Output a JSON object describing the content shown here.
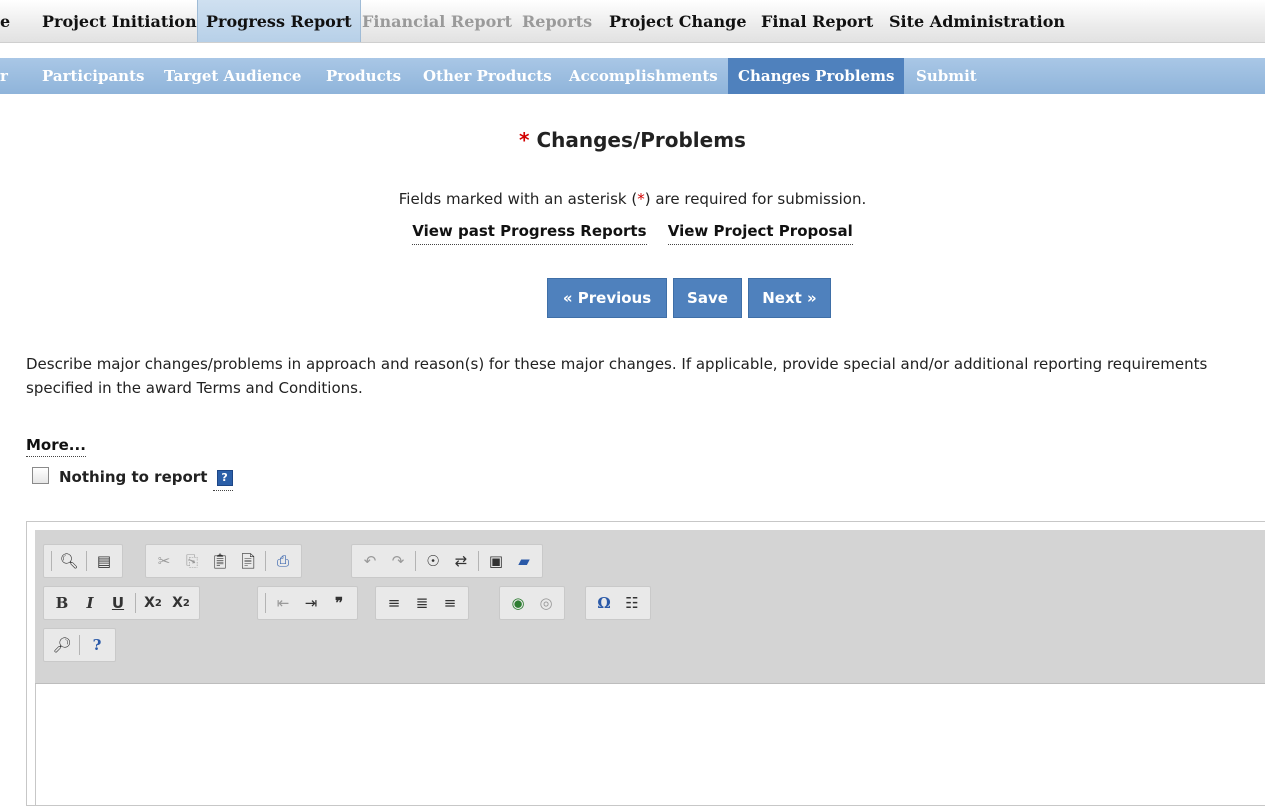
{
  "top_nav": [
    {
      "label": "e",
      "state": "normal"
    },
    {
      "label": "Project Initiation",
      "state": "normal"
    },
    {
      "label": "Progress Report",
      "state": "active"
    },
    {
      "label": "Financial Report",
      "state": "disabled"
    },
    {
      "label": "Reports",
      "state": "disabled"
    },
    {
      "label": "Project Change",
      "state": "normal"
    },
    {
      "label": "Final Report",
      "state": "normal"
    },
    {
      "label": "Site Administration",
      "state": "normal"
    }
  ],
  "sub_nav": [
    {
      "label": "r"
    },
    {
      "label": "Participants"
    },
    {
      "label": "Target Audience"
    },
    {
      "label": "Products"
    },
    {
      "label": "Other Products"
    },
    {
      "label": "Accomplishments"
    },
    {
      "label": "Changes Problems",
      "active": true
    },
    {
      "label": "Submit"
    }
  ],
  "page": {
    "required_marker": "*",
    "title": "Changes/Problems",
    "required_note_prefix": "Fields marked with an asterisk (",
    "required_note_asterisk": "*",
    "required_note_suffix": ") are required for submission.",
    "link_past_reports": "View past Progress Reports",
    "link_proposal": "View Project Proposal",
    "buttons": {
      "previous": "« Previous",
      "save": "Save",
      "next": "Next »"
    },
    "description": "Describe major changes/problems in approach and reason(s) for these major changes. If applicable, provide special and/or additional reporting requirements specified in the award Terms and Conditions.",
    "more_link": "More...",
    "nothing_to_report_label": "Nothing to report",
    "nothing_to_report_checked": false,
    "help_glyph": "?"
  },
  "editor": {
    "toolbar_icons_row1": [
      "preview-icon",
      "templates-icon",
      "cut-icon",
      "copy-icon",
      "paste-icon",
      "paste-from-word-icon",
      "print-icon",
      "undo-icon",
      "redo-icon",
      "find-icon",
      "replace-icon",
      "select-all-icon",
      "remove-format-icon"
    ],
    "toolbar_row2": {
      "bold": "B",
      "italic": "I",
      "underline": "U",
      "subscript_base": "X",
      "subscript_mark": "2",
      "superscript_base": "X",
      "superscript_mark": "2",
      "blockquote": "❞",
      "special_char": "Ω"
    },
    "toolbar_icons_row3": [
      "spellcheck-icon",
      "help-icon"
    ],
    "content": ""
  }
}
